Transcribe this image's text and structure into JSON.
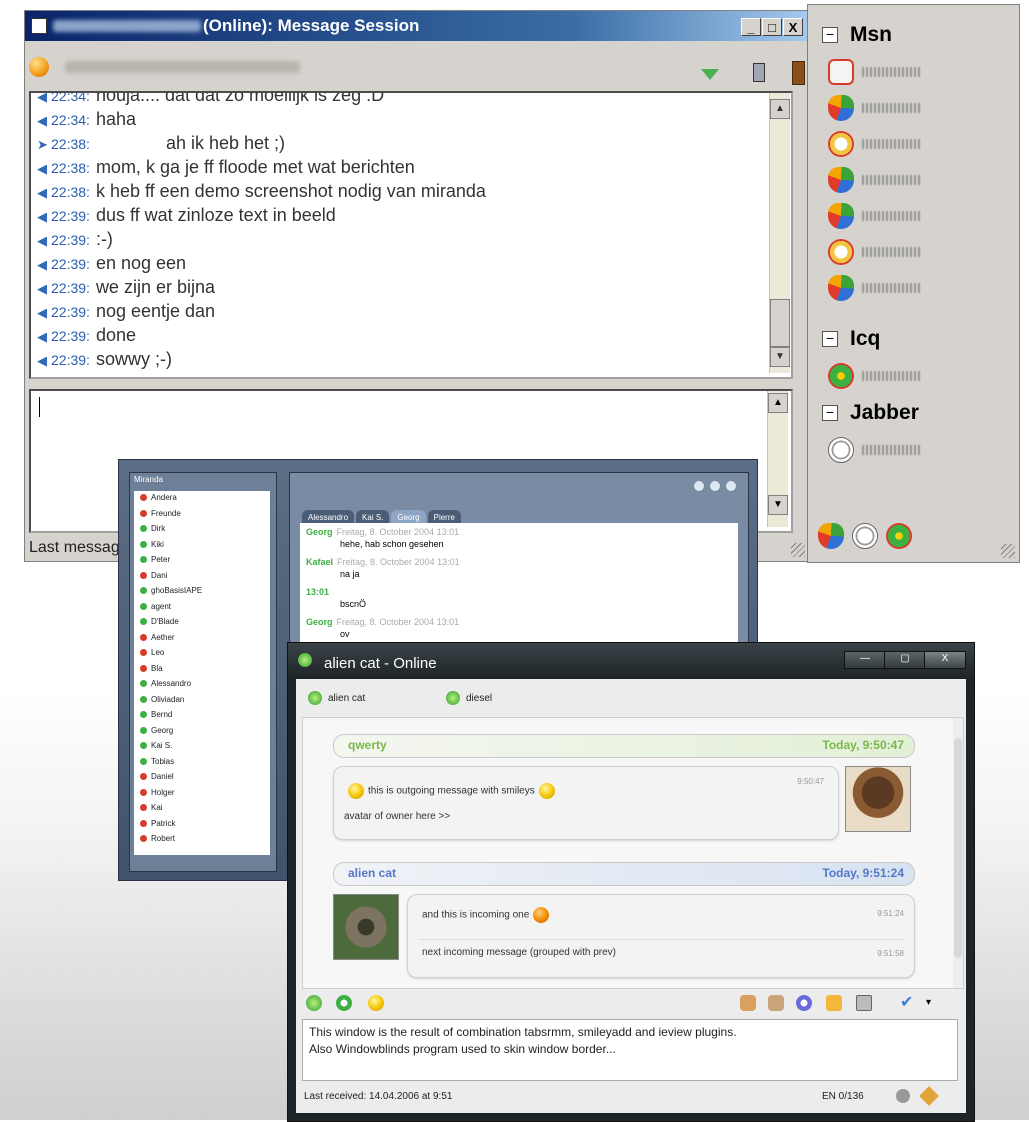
{
  "msg_window": {
    "title": "(Online): Message Session",
    "buttons": {
      "minimize": "_",
      "maximize": "□",
      "close": "X"
    },
    "log": [
      {
        "time": "22:34:",
        "text": "houja.... dat dat zo moeilijk is zeg :D"
      },
      {
        "time": "22:34:",
        "text": "haha"
      },
      {
        "time": "22:38:",
        "text": "ah ik heb het ;)"
      },
      {
        "time": "22:38:",
        "text": "mom, k ga je ff floode met wat berichten"
      },
      {
        "time": "22:38:",
        "text": "k heb ff een demo screenshot nodig van miranda"
      },
      {
        "time": "22:39:",
        "text": "dus ff wat zinloze text in beeld"
      },
      {
        "time": "22:39:",
        "text": ":-)"
      },
      {
        "time": "22:39:",
        "text": "en nog een"
      },
      {
        "time": "22:39:",
        "text": "we zijn er bijna"
      },
      {
        "time": "22:39:",
        "text": "nog eentje dan"
      },
      {
        "time": "22:39:",
        "text": "done"
      },
      {
        "time": "22:39:",
        "text": "sowwy ;-)"
      }
    ],
    "status": "Last messag"
  },
  "contact_list": {
    "groups": [
      {
        "name": "Msn",
        "toggle": "−",
        "contacts": [
          "msg-icon",
          "msn-butterfly-icon",
          "clock-icon",
          "msn-butterfly-icon",
          "msn-butterfly-icon",
          "clock-icon",
          "msn-butterfly-icon"
        ]
      },
      {
        "name": "Icq",
        "toggle": "−",
        "contacts": [
          "icq-flower-icon"
        ]
      },
      {
        "name": "Jabber",
        "toggle": "−",
        "contacts": [
          "jabber-bulb-icon"
        ]
      }
    ],
    "footer_icons": [
      "msn-butterfly-icon",
      "jabber-bulb-icon",
      "icq-flower-icon"
    ]
  },
  "skinned_window": {
    "list_title": "Miranda",
    "contacts": [
      "Andera",
      "Freunde",
      "Dirk",
      "Kiki",
      "Peter",
      "Dani",
      "ghoBasisIAPE",
      "agent",
      "D'Blade",
      "Aether",
      "Leo",
      "Bla",
      "Alessandro",
      "Oliviadan",
      "Bernd",
      "Georg",
      "Kai S.",
      "Tobias",
      "Daniel",
      "Holger",
      "Kai",
      "Patrick",
      "Robert"
    ],
    "tabs": [
      {
        "label": "Alessandro",
        "active": false
      },
      {
        "label": "Kai S.",
        "active": false
      },
      {
        "label": "Georg",
        "active": true
      },
      {
        "label": "Pierre",
        "active": false
      }
    ],
    "log": [
      {
        "name": "Georg",
        "meta": "Freitag, 8. October 2004 13:01",
        "text": "hehe, hab schon gesehen"
      },
      {
        "name": "Kafael",
        "meta": "Freitag, 8. October 2004 13:01",
        "text": "na ja"
      },
      {
        "name": "13:01",
        "meta": "",
        "text": "bscnÖ"
      },
      {
        "name": "Georg",
        "meta": "Freitag, 8. October 2004 13:01",
        "text": "ov"
      }
    ]
  },
  "tabsrmm_window": {
    "title": "alien cat - Online",
    "buttons": {
      "minimize": "—",
      "maximize": "▢",
      "close": "X"
    },
    "tabs": [
      "alien cat",
      "diesel"
    ],
    "groups": [
      {
        "sender": "qwerty",
        "date": "Today, 9:50:47",
        "color": "#7ab84a",
        "messages": [
          {
            "time": "9:50:47",
            "lines": [
              "this is outgoing message with smileys",
              "avatar of owner here >>"
            ]
          }
        ]
      },
      {
        "sender": "alien cat",
        "date": "Today, 9:51:24",
        "color": "#5577c8",
        "messages": [
          {
            "time": "9:51:24",
            "lines": [
              "and this is incoming one"
            ]
          },
          {
            "time": "9:51:58",
            "lines": [
              "next incoming message (grouped with prev)"
            ]
          }
        ]
      }
    ],
    "input_lines": [
      "This window is the result of combination tabsrmm, smileyadd and ieview plugins.",
      "Also Windowblinds program used to skin window border..."
    ],
    "status_left": "Last received: 14.04.2006 at 9:51",
    "status_right": "EN 0/136",
    "toolbar_icons": [
      "protocol-icon",
      "status-icon",
      "smiley-icon",
      "hand-icon",
      "history-icon",
      "info-icon",
      "message-icon",
      "save-icon",
      "send-icon"
    ]
  }
}
